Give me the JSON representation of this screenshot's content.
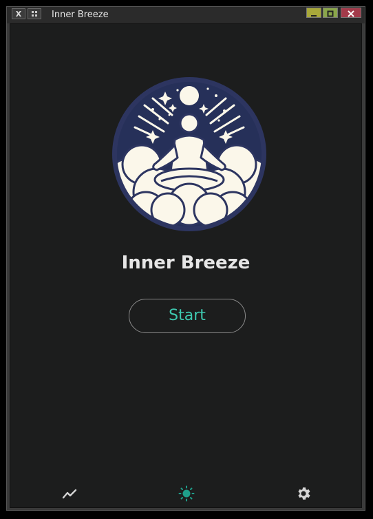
{
  "window": {
    "title": "Inner Breeze"
  },
  "main": {
    "app_name": "Inner Breeze",
    "start_label": "Start",
    "logo": "meditation-logo"
  },
  "bottom_nav": {
    "items": [
      {
        "icon": "chart-line-icon",
        "active": false
      },
      {
        "icon": "sun-icon",
        "active": true
      },
      {
        "icon": "gear-icon",
        "active": false
      }
    ]
  },
  "colors": {
    "accent": "#3ec9b0",
    "background": "#1c1d1d",
    "logo_navy": "#2d3560",
    "logo_cream": "#fbf7ea"
  }
}
